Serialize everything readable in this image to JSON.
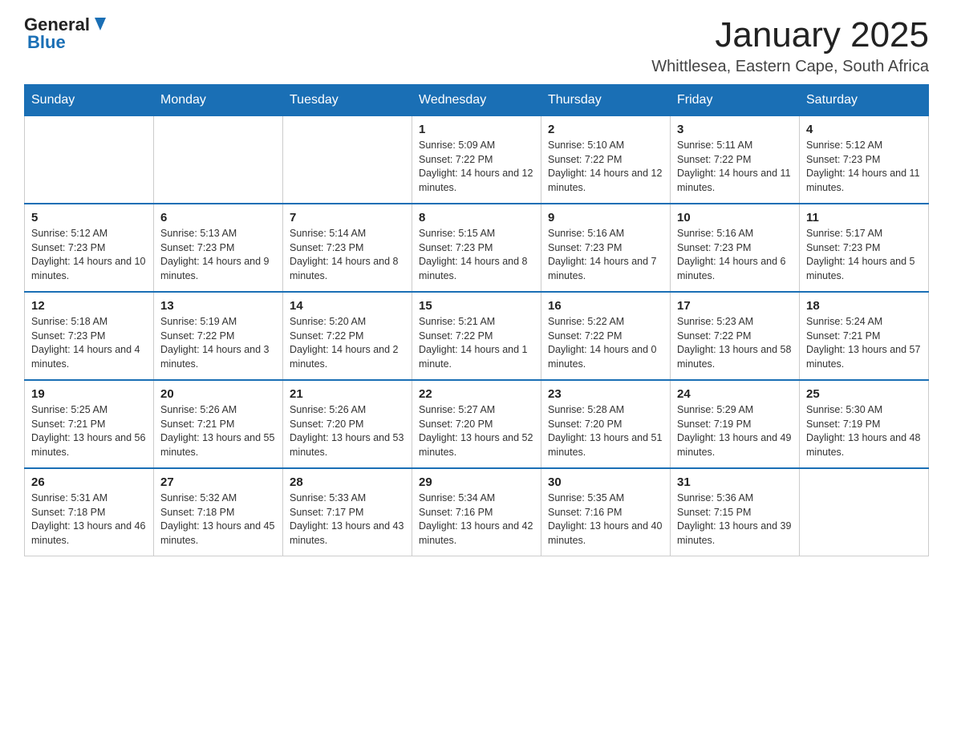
{
  "header": {
    "logo": {
      "general": "General",
      "blue": "Blue"
    },
    "title": "January 2025",
    "subtitle": "Whittlesea, Eastern Cape, South Africa"
  },
  "days_of_week": [
    "Sunday",
    "Monday",
    "Tuesday",
    "Wednesday",
    "Thursday",
    "Friday",
    "Saturday"
  ],
  "weeks": [
    [
      null,
      null,
      null,
      {
        "day": 1,
        "sunrise": "5:09 AM",
        "sunset": "7:22 PM",
        "daylight": "14 hours and 12 minutes."
      },
      {
        "day": 2,
        "sunrise": "5:10 AM",
        "sunset": "7:22 PM",
        "daylight": "14 hours and 12 minutes."
      },
      {
        "day": 3,
        "sunrise": "5:11 AM",
        "sunset": "7:22 PM",
        "daylight": "14 hours and 11 minutes."
      },
      {
        "day": 4,
        "sunrise": "5:12 AM",
        "sunset": "7:23 PM",
        "daylight": "14 hours and 11 minutes."
      }
    ],
    [
      {
        "day": 5,
        "sunrise": "5:12 AM",
        "sunset": "7:23 PM",
        "daylight": "14 hours and 10 minutes."
      },
      {
        "day": 6,
        "sunrise": "5:13 AM",
        "sunset": "7:23 PM",
        "daylight": "14 hours and 9 minutes."
      },
      {
        "day": 7,
        "sunrise": "5:14 AM",
        "sunset": "7:23 PM",
        "daylight": "14 hours and 8 minutes."
      },
      {
        "day": 8,
        "sunrise": "5:15 AM",
        "sunset": "7:23 PM",
        "daylight": "14 hours and 8 minutes."
      },
      {
        "day": 9,
        "sunrise": "5:16 AM",
        "sunset": "7:23 PM",
        "daylight": "14 hours and 7 minutes."
      },
      {
        "day": 10,
        "sunrise": "5:16 AM",
        "sunset": "7:23 PM",
        "daylight": "14 hours and 6 minutes."
      },
      {
        "day": 11,
        "sunrise": "5:17 AM",
        "sunset": "7:23 PM",
        "daylight": "14 hours and 5 minutes."
      }
    ],
    [
      {
        "day": 12,
        "sunrise": "5:18 AM",
        "sunset": "7:23 PM",
        "daylight": "14 hours and 4 minutes."
      },
      {
        "day": 13,
        "sunrise": "5:19 AM",
        "sunset": "7:22 PM",
        "daylight": "14 hours and 3 minutes."
      },
      {
        "day": 14,
        "sunrise": "5:20 AM",
        "sunset": "7:22 PM",
        "daylight": "14 hours and 2 minutes."
      },
      {
        "day": 15,
        "sunrise": "5:21 AM",
        "sunset": "7:22 PM",
        "daylight": "14 hours and 1 minute."
      },
      {
        "day": 16,
        "sunrise": "5:22 AM",
        "sunset": "7:22 PM",
        "daylight": "14 hours and 0 minutes."
      },
      {
        "day": 17,
        "sunrise": "5:23 AM",
        "sunset": "7:22 PM",
        "daylight": "13 hours and 58 minutes."
      },
      {
        "day": 18,
        "sunrise": "5:24 AM",
        "sunset": "7:21 PM",
        "daylight": "13 hours and 57 minutes."
      }
    ],
    [
      {
        "day": 19,
        "sunrise": "5:25 AM",
        "sunset": "7:21 PM",
        "daylight": "13 hours and 56 minutes."
      },
      {
        "day": 20,
        "sunrise": "5:26 AM",
        "sunset": "7:21 PM",
        "daylight": "13 hours and 55 minutes."
      },
      {
        "day": 21,
        "sunrise": "5:26 AM",
        "sunset": "7:20 PM",
        "daylight": "13 hours and 53 minutes."
      },
      {
        "day": 22,
        "sunrise": "5:27 AM",
        "sunset": "7:20 PM",
        "daylight": "13 hours and 52 minutes."
      },
      {
        "day": 23,
        "sunrise": "5:28 AM",
        "sunset": "7:20 PM",
        "daylight": "13 hours and 51 minutes."
      },
      {
        "day": 24,
        "sunrise": "5:29 AM",
        "sunset": "7:19 PM",
        "daylight": "13 hours and 49 minutes."
      },
      {
        "day": 25,
        "sunrise": "5:30 AM",
        "sunset": "7:19 PM",
        "daylight": "13 hours and 48 minutes."
      }
    ],
    [
      {
        "day": 26,
        "sunrise": "5:31 AM",
        "sunset": "7:18 PM",
        "daylight": "13 hours and 46 minutes."
      },
      {
        "day": 27,
        "sunrise": "5:32 AM",
        "sunset": "7:18 PM",
        "daylight": "13 hours and 45 minutes."
      },
      {
        "day": 28,
        "sunrise": "5:33 AM",
        "sunset": "7:17 PM",
        "daylight": "13 hours and 43 minutes."
      },
      {
        "day": 29,
        "sunrise": "5:34 AM",
        "sunset": "7:16 PM",
        "daylight": "13 hours and 42 minutes."
      },
      {
        "day": 30,
        "sunrise": "5:35 AM",
        "sunset": "7:16 PM",
        "daylight": "13 hours and 40 minutes."
      },
      {
        "day": 31,
        "sunrise": "5:36 AM",
        "sunset": "7:15 PM",
        "daylight": "13 hours and 39 minutes."
      },
      null
    ]
  ]
}
